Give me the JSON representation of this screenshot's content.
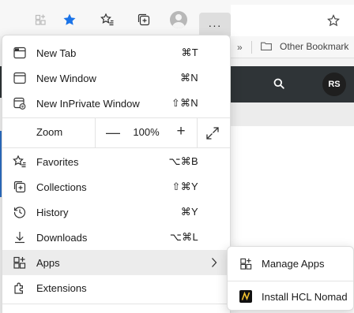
{
  "bookmarks_bar": {
    "overflow_glyph": "»",
    "folder_label": "Other Bookmark"
  },
  "site_header": {
    "user_initials": "RS"
  },
  "toolbar": {
    "more_label": "···"
  },
  "menu": {
    "items": [
      {
        "label": "New Tab",
        "shortcut": "⌘T",
        "icon": "new-tab-icon"
      },
      {
        "label": "New Window",
        "shortcut": "⌘N",
        "icon": "new-window-icon"
      },
      {
        "label": "New InPrivate Window",
        "shortcut": "⇧⌘N",
        "icon": "inprivate-window-icon"
      },
      {
        "label": "Favorites",
        "shortcut": "⌥⌘B",
        "icon": "favorites-icon"
      },
      {
        "label": "Collections",
        "shortcut": "⇧⌘Y",
        "icon": "collections-icon"
      },
      {
        "label": "History",
        "shortcut": "⌘Y",
        "icon": "history-icon"
      },
      {
        "label": "Downloads",
        "shortcut": "⌥⌘L",
        "icon": "downloads-icon"
      },
      {
        "label": "Apps",
        "shortcut": "",
        "icon": "apps-icon"
      },
      {
        "label": "Extensions",
        "shortcut": "",
        "icon": "extensions-icon"
      }
    ],
    "zoom": {
      "label": "Zoom",
      "value": "100%",
      "minus": "—",
      "plus": "+"
    }
  },
  "submenu": {
    "items": [
      {
        "label": "Manage Apps",
        "icon": "apps-icon"
      },
      {
        "label": "Install HCL Nomad",
        "icon": "hcl-nomad-logo"
      }
    ]
  },
  "colors": {
    "accent_blue": "#2d6fc4",
    "dark_header": "#2f3437",
    "hover_bg": "#ececec"
  }
}
